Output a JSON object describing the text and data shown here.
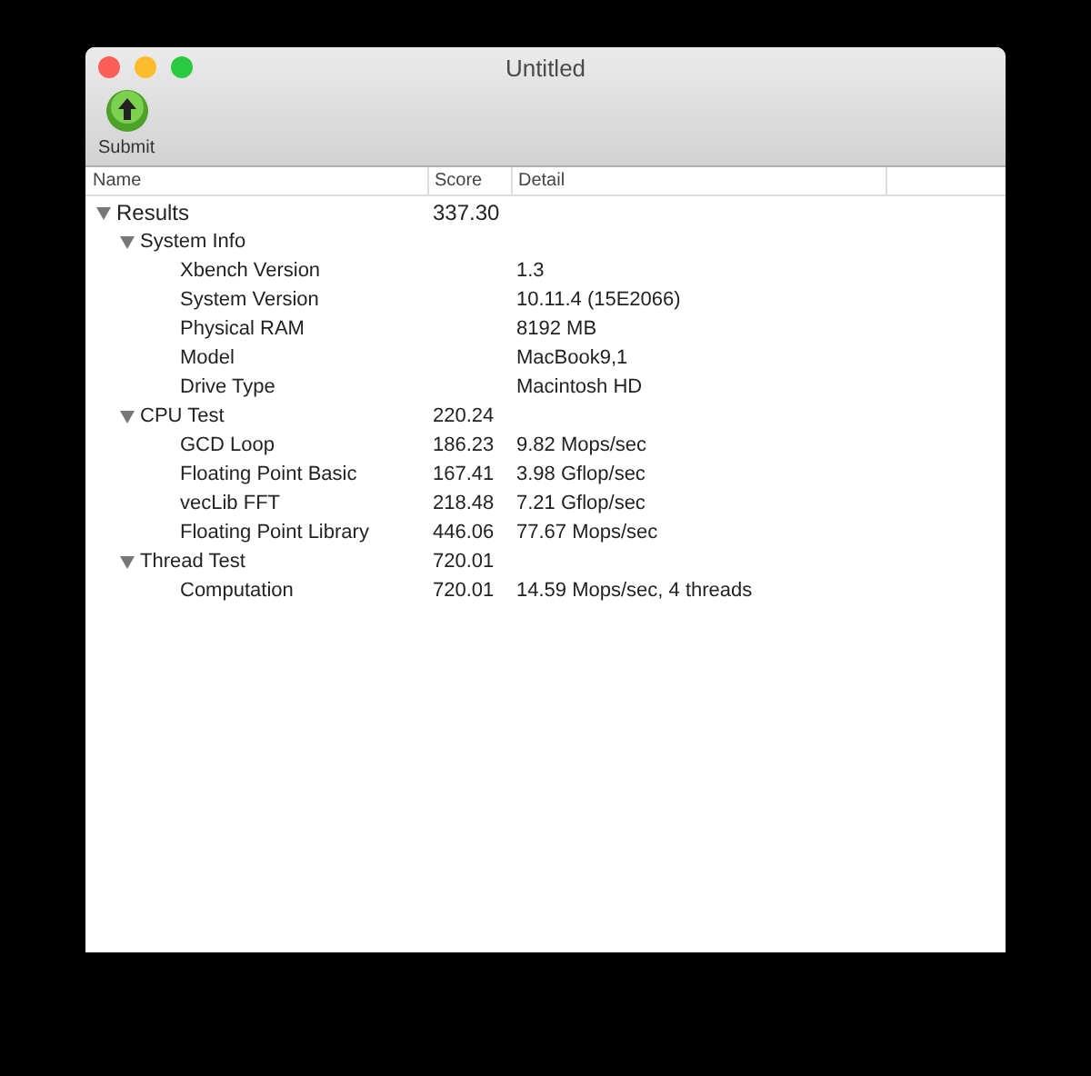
{
  "window": {
    "title": "Untitled"
  },
  "toolbar": {
    "items": [
      {
        "label": "Submit"
      }
    ]
  },
  "table": {
    "columns": [
      "Name",
      "Score",
      "Detail"
    ],
    "rows": [
      {
        "name": "Results",
        "score": "337.30",
        "expanded": true,
        "children": [
          {
            "name": "System Info",
            "expanded": true,
            "children": [
              {
                "name": "Xbench Version",
                "detail": "1.3"
              },
              {
                "name": "System Version",
                "detail": "10.11.4 (15E2066)"
              },
              {
                "name": "Physical RAM",
                "detail": "8192 MB"
              },
              {
                "name": "Model",
                "detail": "MacBook9,1"
              },
              {
                "name": "Drive Type",
                "detail": "Macintosh HD"
              }
            ]
          },
          {
            "name": "CPU Test",
            "score": "220.24",
            "expanded": true,
            "children": [
              {
                "name": "GCD Loop",
                "score": "186.23",
                "detail": "9.82 Mops/sec"
              },
              {
                "name": "Floating Point Basic",
                "score": "167.41",
                "detail": "3.98 Gflop/sec"
              },
              {
                "name": "vecLib FFT",
                "score": "218.48",
                "detail": "7.21 Gflop/sec"
              },
              {
                "name": "Floating Point Library",
                "score": "446.06",
                "detail": "77.67 Mops/sec"
              }
            ]
          },
          {
            "name": "Thread Test",
            "score": "720.01",
            "expanded": true,
            "children": [
              {
                "name": "Computation",
                "score": "720.01",
                "detail": "14.59 Mops/sec, 4 threads"
              }
            ]
          }
        ]
      }
    ]
  }
}
